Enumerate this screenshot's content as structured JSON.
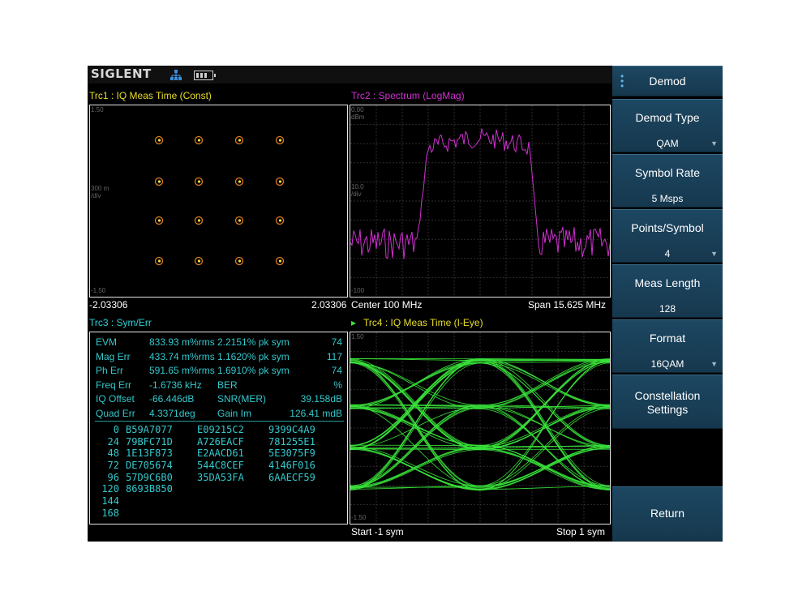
{
  "header": {
    "logo": "SIGLENT",
    "icons": [
      "network-icon",
      "battery-icon"
    ]
  },
  "traces": {
    "trc1": {
      "label": "Trc1 :  IQ Meas Time  (Const)",
      "scale_top": "1.50",
      "scale_div": "300 m\n/div",
      "scale_bottom": "-1.50",
      "x_left": "-2.03306",
      "x_right": "2.03306"
    },
    "trc2": {
      "label": "Trc2 :  Spectrum  (LogMag)",
      "scale_top": "0.00\ndBm",
      "scale_div": "10.0\n/div",
      "scale_bottom": "-100",
      "center": "Center 100 MHz",
      "span": "Span 15.625 MHz"
    },
    "trc3": {
      "label": "Trc3 :  Sym/Err"
    },
    "trc4": {
      "label": "Trc4 :  IQ Meas Time  (I-Eye)",
      "scale_top": "1.50",
      "scale_bottom": "-1.50",
      "start": "Start -1 sym",
      "stop": "Stop 1 sym"
    }
  },
  "errors": [
    [
      "EVM",
      "833.93 m%rms",
      "2.2151% pk sym",
      "74"
    ],
    [
      "Mag Err",
      "433.74 m%rms",
      "1.1620% pk sym",
      "117"
    ],
    [
      "Ph Err",
      "591.65 m%rms",
      "1.6910% pk sym",
      "74"
    ],
    [
      "Freq Err",
      "-1.6736 kHz",
      "BER",
      "%"
    ],
    [
      "IQ Offset",
      "-66.446dB",
      "SNR(MER)",
      "39.158dB"
    ],
    [
      "Quad Err",
      "4.3371deg",
      "Gain Im",
      "126.41 mdB"
    ]
  ],
  "symbols": [
    [
      "0",
      "B59A7077",
      "E09215C2",
      "9399C4A9"
    ],
    [
      "24",
      "79BFC71D",
      "A726EACF",
      "781255E1"
    ],
    [
      "48",
      "1E13F873",
      "E2AACD61",
      "5E3075F9"
    ],
    [
      "72",
      "DE705674",
      "544C8CEF",
      "4146F016"
    ],
    [
      "96",
      "57D9C6B0",
      "35DA53FA",
      "6AAECF59"
    ],
    [
      "120",
      "8693B850",
      "",
      ""
    ],
    [
      "144",
      "",
      "",
      ""
    ],
    [
      "168",
      "",
      "",
      ""
    ]
  ],
  "softkeys": {
    "title": "Demod",
    "demod_type": {
      "label": "Demod Type",
      "value": "QAM"
    },
    "symbol_rate": {
      "label": "Symbol Rate",
      "value": "5 Msps"
    },
    "points_symbol": {
      "label": "Points/Symbol",
      "value": "4"
    },
    "meas_length": {
      "label": "Meas Length",
      "value": "128"
    },
    "format": {
      "label": "Format",
      "value": "16QAM"
    },
    "constellation": {
      "label_line1": "Constellation",
      "label_line2": "Settings"
    },
    "return": "Return"
  },
  "colors": {
    "trace1": "#e8df2a",
    "trace2": "#d22fd2",
    "trace3": "#2fd0d8",
    "eye": "#39e23a",
    "softkey": "#1d4762"
  }
}
